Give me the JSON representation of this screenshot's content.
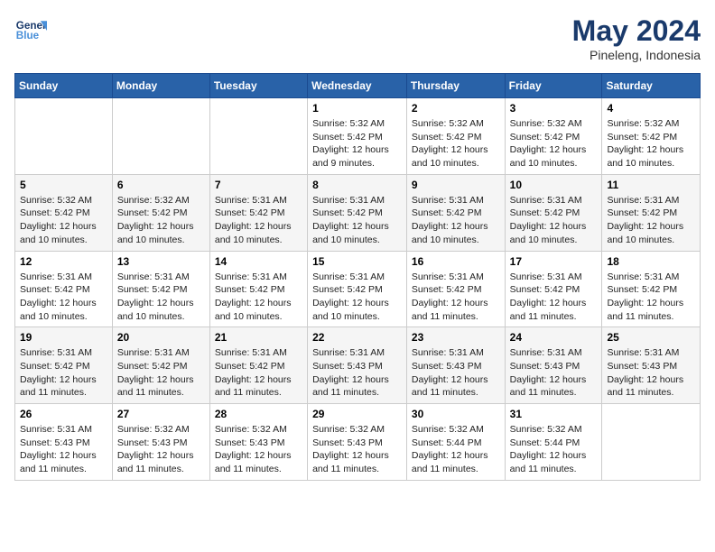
{
  "logo": {
    "general": "General",
    "blue": "Blue"
  },
  "title": {
    "month": "May 2024",
    "location": "Pineleng, Indonesia"
  },
  "header_days": [
    "Sunday",
    "Monday",
    "Tuesday",
    "Wednesday",
    "Thursday",
    "Friday",
    "Saturday"
  ],
  "weeks": [
    [
      {
        "day": "",
        "info": ""
      },
      {
        "day": "",
        "info": ""
      },
      {
        "day": "",
        "info": ""
      },
      {
        "day": "1",
        "info": "Sunrise: 5:32 AM\nSunset: 5:42 PM\nDaylight: 12 hours\nand 9 minutes."
      },
      {
        "day": "2",
        "info": "Sunrise: 5:32 AM\nSunset: 5:42 PM\nDaylight: 12 hours\nand 10 minutes."
      },
      {
        "day": "3",
        "info": "Sunrise: 5:32 AM\nSunset: 5:42 PM\nDaylight: 12 hours\nand 10 minutes."
      },
      {
        "day": "4",
        "info": "Sunrise: 5:32 AM\nSunset: 5:42 PM\nDaylight: 12 hours\nand 10 minutes."
      }
    ],
    [
      {
        "day": "5",
        "info": "Sunrise: 5:32 AM\nSunset: 5:42 PM\nDaylight: 12 hours\nand 10 minutes."
      },
      {
        "day": "6",
        "info": "Sunrise: 5:32 AM\nSunset: 5:42 PM\nDaylight: 12 hours\nand 10 minutes."
      },
      {
        "day": "7",
        "info": "Sunrise: 5:31 AM\nSunset: 5:42 PM\nDaylight: 12 hours\nand 10 minutes."
      },
      {
        "day": "8",
        "info": "Sunrise: 5:31 AM\nSunset: 5:42 PM\nDaylight: 12 hours\nand 10 minutes."
      },
      {
        "day": "9",
        "info": "Sunrise: 5:31 AM\nSunset: 5:42 PM\nDaylight: 12 hours\nand 10 minutes."
      },
      {
        "day": "10",
        "info": "Sunrise: 5:31 AM\nSunset: 5:42 PM\nDaylight: 12 hours\nand 10 minutes."
      },
      {
        "day": "11",
        "info": "Sunrise: 5:31 AM\nSunset: 5:42 PM\nDaylight: 12 hours\nand 10 minutes."
      }
    ],
    [
      {
        "day": "12",
        "info": "Sunrise: 5:31 AM\nSunset: 5:42 PM\nDaylight: 12 hours\nand 10 minutes."
      },
      {
        "day": "13",
        "info": "Sunrise: 5:31 AM\nSunset: 5:42 PM\nDaylight: 12 hours\nand 10 minutes."
      },
      {
        "day": "14",
        "info": "Sunrise: 5:31 AM\nSunset: 5:42 PM\nDaylight: 12 hours\nand 10 minutes."
      },
      {
        "day": "15",
        "info": "Sunrise: 5:31 AM\nSunset: 5:42 PM\nDaylight: 12 hours\nand 10 minutes."
      },
      {
        "day": "16",
        "info": "Sunrise: 5:31 AM\nSunset: 5:42 PM\nDaylight: 12 hours\nand 11 minutes."
      },
      {
        "day": "17",
        "info": "Sunrise: 5:31 AM\nSunset: 5:42 PM\nDaylight: 12 hours\nand 11 minutes."
      },
      {
        "day": "18",
        "info": "Sunrise: 5:31 AM\nSunset: 5:42 PM\nDaylight: 12 hours\nand 11 minutes."
      }
    ],
    [
      {
        "day": "19",
        "info": "Sunrise: 5:31 AM\nSunset: 5:42 PM\nDaylight: 12 hours\nand 11 minutes."
      },
      {
        "day": "20",
        "info": "Sunrise: 5:31 AM\nSunset: 5:42 PM\nDaylight: 12 hours\nand 11 minutes."
      },
      {
        "day": "21",
        "info": "Sunrise: 5:31 AM\nSunset: 5:42 PM\nDaylight: 12 hours\nand 11 minutes."
      },
      {
        "day": "22",
        "info": "Sunrise: 5:31 AM\nSunset: 5:43 PM\nDaylight: 12 hours\nand 11 minutes."
      },
      {
        "day": "23",
        "info": "Sunrise: 5:31 AM\nSunset: 5:43 PM\nDaylight: 12 hours\nand 11 minutes."
      },
      {
        "day": "24",
        "info": "Sunrise: 5:31 AM\nSunset: 5:43 PM\nDaylight: 12 hours\nand 11 minutes."
      },
      {
        "day": "25",
        "info": "Sunrise: 5:31 AM\nSunset: 5:43 PM\nDaylight: 12 hours\nand 11 minutes."
      }
    ],
    [
      {
        "day": "26",
        "info": "Sunrise: 5:31 AM\nSunset: 5:43 PM\nDaylight: 12 hours\nand 11 minutes."
      },
      {
        "day": "27",
        "info": "Sunrise: 5:32 AM\nSunset: 5:43 PM\nDaylight: 12 hours\nand 11 minutes."
      },
      {
        "day": "28",
        "info": "Sunrise: 5:32 AM\nSunset: 5:43 PM\nDaylight: 12 hours\nand 11 minutes."
      },
      {
        "day": "29",
        "info": "Sunrise: 5:32 AM\nSunset: 5:43 PM\nDaylight: 12 hours\nand 11 minutes."
      },
      {
        "day": "30",
        "info": "Sunrise: 5:32 AM\nSunset: 5:44 PM\nDaylight: 12 hours\nand 11 minutes."
      },
      {
        "day": "31",
        "info": "Sunrise: 5:32 AM\nSunset: 5:44 PM\nDaylight: 12 hours\nand 11 minutes."
      },
      {
        "day": "",
        "info": ""
      }
    ]
  ]
}
